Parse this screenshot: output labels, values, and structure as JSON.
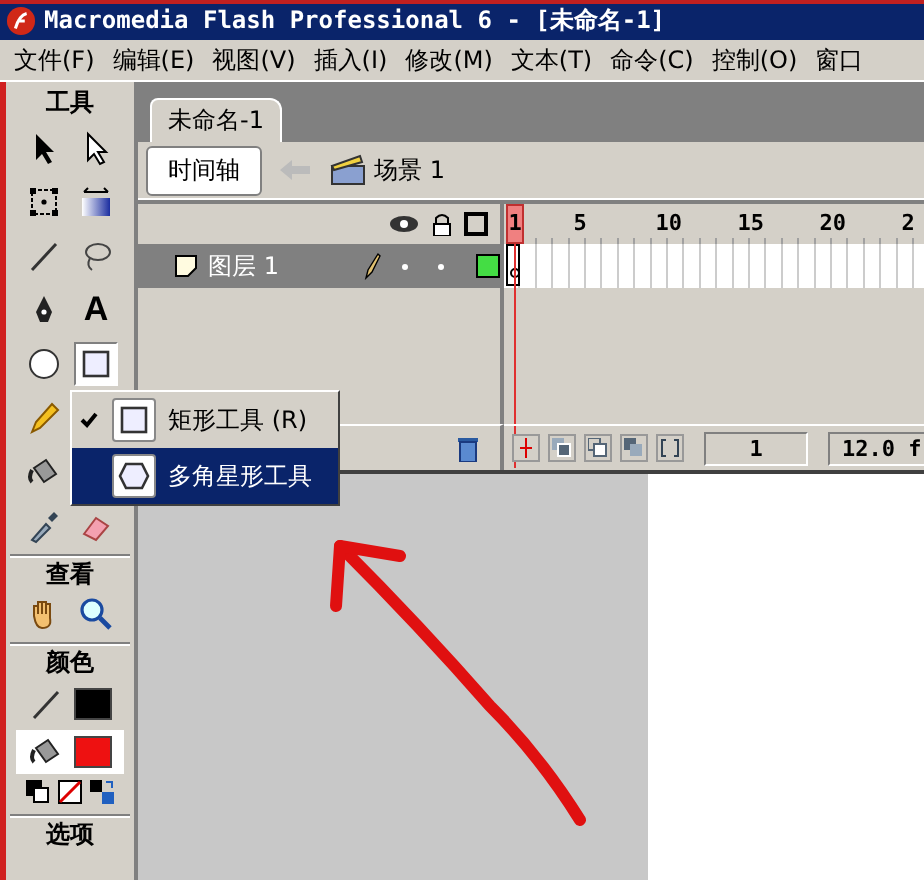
{
  "window": {
    "title": "Macromedia Flash Professional 6 - [未命名-1]"
  },
  "menu": [
    "文件(F)",
    "编辑(E)",
    "视图(V)",
    "插入(I)",
    "修改(M)",
    "文本(T)",
    "命令(C)",
    "控制(O)",
    "窗口"
  ],
  "toolbox": {
    "tools_label": "工具",
    "tool_rows": [
      [
        {
          "kind": "arrow",
          "selected": false
        },
        {
          "kind": "subselect",
          "selected": false
        }
      ],
      [
        {
          "kind": "transform",
          "selected": false
        },
        {
          "kind": "fill-transform",
          "selected": false
        }
      ],
      [
        {
          "kind": "line",
          "selected": false
        },
        {
          "kind": "lasso",
          "selected": false
        }
      ],
      [
        {
          "kind": "pen",
          "selected": false
        },
        {
          "kind": "text",
          "label": "A",
          "selected": false
        }
      ],
      [
        {
          "kind": "oval",
          "selected": false
        },
        {
          "kind": "rect",
          "selected": true
        }
      ],
      [
        {
          "kind": "pencil",
          "selected": false
        }
      ],
      [
        {
          "kind": "bucket",
          "selected": false
        }
      ],
      [
        {
          "kind": "dropper",
          "selected": false
        },
        {
          "kind": "eraser",
          "selected": false
        }
      ]
    ],
    "view_label": "查看",
    "view_tools": [
      {
        "kind": "hand",
        "selected": false
      },
      {
        "kind": "zoom",
        "selected": false
      }
    ],
    "colors_label": "颜色",
    "options_label": "选项"
  },
  "document": {
    "tab": "未命名-1",
    "timeline_button": "时间轴",
    "scene": "场景 1"
  },
  "timeline": {
    "frame_numbers": [
      "1",
      "5",
      "10",
      "15",
      "20",
      "2"
    ],
    "layers": [
      {
        "name": "图层 1",
        "selected": true,
        "color": "#44dd44"
      }
    ],
    "current_frame": "1",
    "frame_rate": "12.0 f"
  },
  "popup_menu": [
    {
      "label": "矩形工具 (R)",
      "kind": "rect",
      "checked": true,
      "selected": false
    },
    {
      "label": "多角星形工具",
      "kind": "polystar",
      "checked": false,
      "selected": true
    }
  ]
}
